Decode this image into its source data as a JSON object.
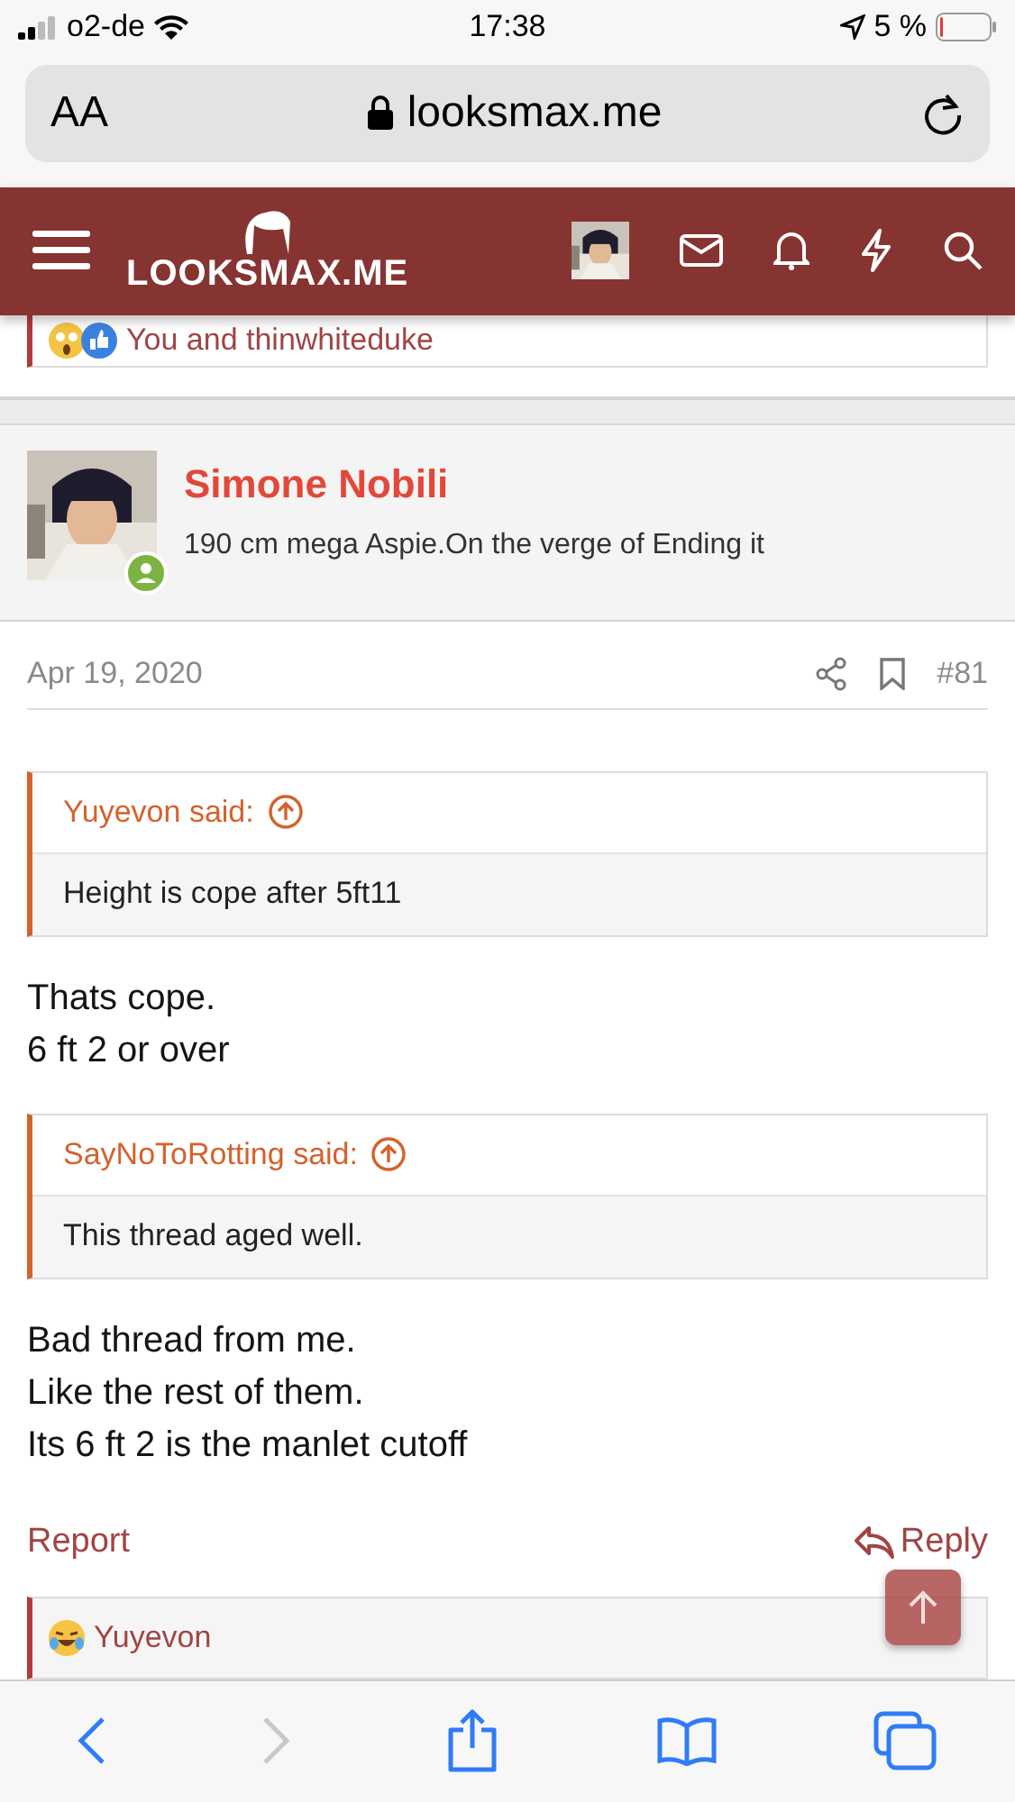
{
  "status_bar": {
    "carrier": "o2-de",
    "time": "17:38",
    "battery": "5 %"
  },
  "address_bar": {
    "text_size": "AA",
    "url": "looksmax.me"
  },
  "site_header": {
    "logo": "LOOKSMAX.ME"
  },
  "reactions_top": {
    "text": "You and thinwhiteduke"
  },
  "post": {
    "author": "Simone Nobili",
    "online": true,
    "user_title": "190 cm mega Aspie.On the verge of Ending it",
    "date": "Apr 19, 2020",
    "number": "#81",
    "blocks": [
      {
        "kind": "quote",
        "author": "Yuyevon said:",
        "text": "Height is cope after 5ft11"
      },
      {
        "kind": "text",
        "lines": [
          "Thats cope.",
          "6 ft 2 or over"
        ]
      },
      {
        "kind": "quote",
        "author": "SayNoToRotting said:",
        "text": "This thread aged well."
      },
      {
        "kind": "text",
        "lines": [
          "Bad thread from me.",
          "Like the rest of them.",
          "Its 6 ft 2 is the manlet cutoff"
        ]
      }
    ],
    "actions": {
      "report": "Report",
      "reply": "Reply"
    },
    "reactions": {
      "text": "Yuyevon"
    }
  },
  "toolbar": {
    "back_enabled": true,
    "forward_enabled": false
  }
}
